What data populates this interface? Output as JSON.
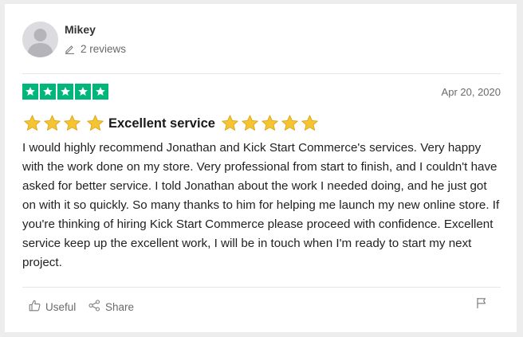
{
  "reviewer": {
    "name": "Mikey",
    "review_count": "2 reviews"
  },
  "rating": {
    "stars": 5,
    "max": 5,
    "color": "#00b67a"
  },
  "date": "Apr 20, 2020",
  "review": {
    "title": "Excellent service",
    "title_stars_before": 4,
    "title_stars_after": 5,
    "star_emoji_color": "#f6c431",
    "body": "I would highly recommend Jonathan and Kick Start Commerce's services. Very happy with the work done on my store. Very professional from start to finish, and I couldn't have asked for better service. I told Jonathan about the work I needed doing, and he just got on with it so quickly. So many thanks to him for helping me launch my new online store. If you're thinking of hiring Kick Start Commerce please proceed with confidence. Excellent service keep up the excellent work, I will be in touch when I'm ready to start my next project."
  },
  "actions": {
    "useful_label": "Useful",
    "share_label": "Share"
  },
  "icons": {
    "avatar": "user-silhouette-icon",
    "review_count": "pencil-icon",
    "useful": "thumbs-up-icon",
    "share": "share-icon",
    "report": "flag-icon"
  }
}
